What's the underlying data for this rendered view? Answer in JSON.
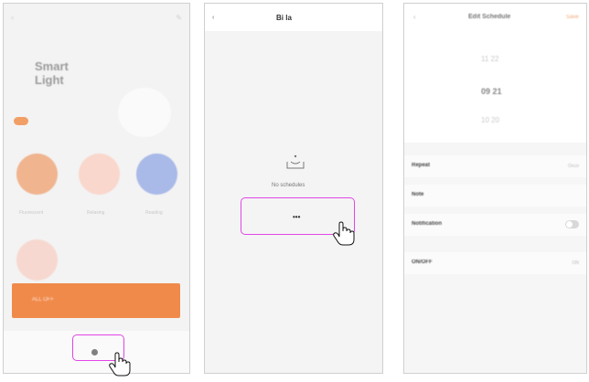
{
  "screen1": {
    "title": "Smart\nLight",
    "scene_labels": [
      "Fluorescent",
      "Relaxing",
      "Reading"
    ],
    "button_label": "ALL OFF",
    "colors": {
      "orange": "#f08a4b",
      "scene1": "#f0b48f",
      "scene2": "#f9d7cc",
      "scene3": "#a9b9e8",
      "highlight": "#e046e6"
    }
  },
  "screen2": {
    "title": "Bi la",
    "empty_text": "No schedules",
    "add_button": "•••"
  },
  "screen3": {
    "title": "Edit Schedule",
    "save_label": "Save",
    "time_rows": [
      "11  22",
      "09  21",
      "10  20"
    ],
    "settings": [
      {
        "label": "Repeat",
        "value": "Once"
      },
      {
        "label": "Note",
        "value": ""
      },
      {
        "label": "Notification",
        "value": ""
      },
      {
        "label": "ON/OFF",
        "value": "ON"
      }
    ]
  }
}
